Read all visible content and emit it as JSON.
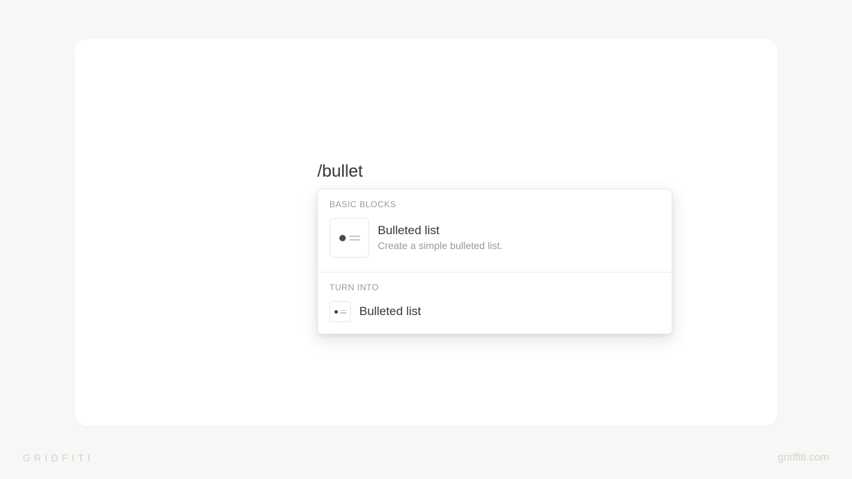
{
  "editor": {
    "slash_command": "/bullet"
  },
  "menu": {
    "sections": [
      {
        "header": "BASIC BLOCKS",
        "items": [
          {
            "title": "Bulleted list",
            "description": "Create a simple bulleted list.",
            "icon": "bulleted-list-icon"
          }
        ]
      },
      {
        "header": "TURN INTO",
        "items": [
          {
            "title": "Bulleted list",
            "icon": "bulleted-list-icon"
          }
        ]
      }
    ]
  },
  "watermark": {
    "left": "GRIDFITI",
    "right": "gridfiti.com"
  }
}
